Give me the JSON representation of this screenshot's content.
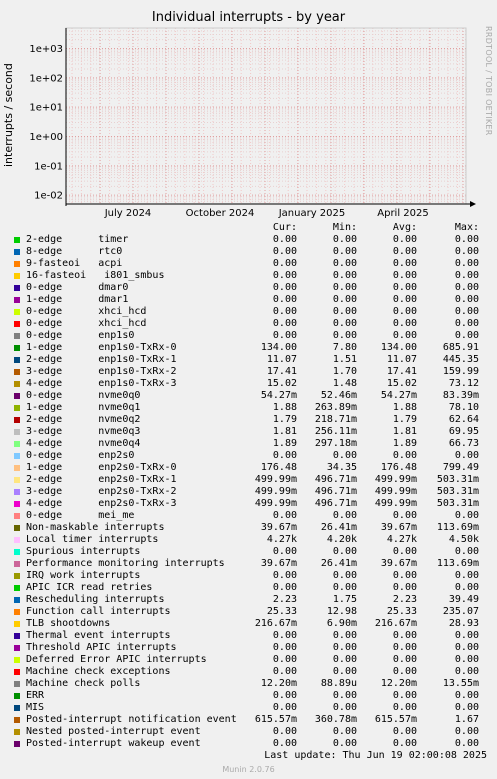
{
  "title": "Individual interrupts - by year",
  "side_text": "RRDTOOL / TOBI OETIKER",
  "chart_data": {
    "type": "line",
    "title": "Individual interrupts - by year",
    "ylabel": "interrupts / second",
    "yscale": "log",
    "ylim": [
      0.005,
      5000
    ],
    "y_ticks": [
      "1e-02",
      "1e-01",
      "1e+00",
      "1e+01",
      "1e+02",
      "1e+03"
    ],
    "x_ticks": [
      "July 2024",
      "October 2024",
      "January 2025",
      "April 2025"
    ],
    "grid": true
  },
  "legend_headers": {
    "cur": "Cur:",
    "min": "Min:",
    "avg": "Avg:",
    "max": "Max:"
  },
  "legend": [
    {
      "name": "2-edge      timer",
      "color": "#00cc00",
      "cur": "0.00",
      "min": "0.00",
      "avg": "0.00",
      "max": "0.00"
    },
    {
      "name": "8-edge      rtc0",
      "color": "#0066b3",
      "cur": "0.00",
      "min": "0.00",
      "avg": "0.00",
      "max": "0.00"
    },
    {
      "name": "9-fasteoi   acpi",
      "color": "#ff8000",
      "cur": "0.00",
      "min": "0.00",
      "avg": "0.00",
      "max": "0.00"
    },
    {
      "name": "16-fasteoi   i801_smbus",
      "color": "#ffcc00",
      "cur": "0.00",
      "min": "0.00",
      "avg": "0.00",
      "max": "0.00"
    },
    {
      "name": "0-edge      dmar0",
      "color": "#330099",
      "cur": "0.00",
      "min": "0.00",
      "avg": "0.00",
      "max": "0.00"
    },
    {
      "name": "1-edge      dmar1",
      "color": "#990099",
      "cur": "0.00",
      "min": "0.00",
      "avg": "0.00",
      "max": "0.00"
    },
    {
      "name": "0-edge      xhci_hcd",
      "color": "#ccff00",
      "cur": "0.00",
      "min": "0.00",
      "avg": "0.00",
      "max": "0.00"
    },
    {
      "name": "0-edge      xhci_hcd",
      "color": "#ff0000",
      "cur": "0.00",
      "min": "0.00",
      "avg": "0.00",
      "max": "0.00"
    },
    {
      "name": "0-edge      enp1s0",
      "color": "#808080",
      "cur": "0.00",
      "min": "0.00",
      "avg": "0.00",
      "max": "0.00"
    },
    {
      "name": "1-edge      enp1s0-TxRx-0",
      "color": "#008f00",
      "cur": "134.00",
      "min": "7.80",
      "avg": "134.00",
      "max": "685.91"
    },
    {
      "name": "2-edge      enp1s0-TxRx-1",
      "color": "#00487d",
      "cur": "11.07",
      "min": "1.51",
      "avg": "11.07",
      "max": "445.35"
    },
    {
      "name": "3-edge      enp1s0-TxRx-2",
      "color": "#b35a00",
      "cur": "17.41",
      "min": "1.70",
      "avg": "17.41",
      "max": "159.99"
    },
    {
      "name": "4-edge      enp1s0-TxRx-3",
      "color": "#b38f00",
      "cur": "15.02",
      "min": "1.48",
      "avg": "15.02",
      "max": "73.12"
    },
    {
      "name": "0-edge      nvme0q0",
      "color": "#6b006b",
      "cur": "54.27m",
      "min": "52.46m",
      "avg": "54.27m",
      "max": "83.39m"
    },
    {
      "name": "1-edge      nvme0q1",
      "color": "#8fb300",
      "cur": "1.88",
      "min": "263.89m",
      "avg": "1.88",
      "max": "78.10"
    },
    {
      "name": "2-edge      nvme0q2",
      "color": "#b30000",
      "cur": "1.79",
      "min": "218.71m",
      "avg": "1.79",
      "max": "62.64"
    },
    {
      "name": "3-edge      nvme0q3",
      "color": "#bebebe",
      "cur": "1.81",
      "min": "256.11m",
      "avg": "1.81",
      "max": "69.95"
    },
    {
      "name": "4-edge      nvme0q4",
      "color": "#80ff80",
      "cur": "1.89",
      "min": "297.18m",
      "avg": "1.89",
      "max": "66.73"
    },
    {
      "name": "0-edge      enp2s0",
      "color": "#80c9ff",
      "cur": "0.00",
      "min": "0.00",
      "avg": "0.00",
      "max": "0.00"
    },
    {
      "name": "1-edge      enp2s0-TxRx-0",
      "color": "#ffc080",
      "cur": "176.48",
      "min": "34.35",
      "avg": "176.48",
      "max": "799.49"
    },
    {
      "name": "2-edge      enp2s0-TxRx-1",
      "color": "#ffe680",
      "cur": "499.99m",
      "min": "496.71m",
      "avg": "499.99m",
      "max": "503.31m"
    },
    {
      "name": "3-edge      enp2s0-TxRx-2",
      "color": "#aa80ff",
      "cur": "499.99m",
      "min": "496.71m",
      "avg": "499.99m",
      "max": "503.31m"
    },
    {
      "name": "4-edge      enp2s0-TxRx-3",
      "color": "#ee00cc",
      "cur": "499.99m",
      "min": "496.71m",
      "avg": "499.99m",
      "max": "503.31m"
    },
    {
      "name": "0-edge      mei_me",
      "color": "#ff8080",
      "cur": "0.00",
      "min": "0.00",
      "avg": "0.00",
      "max": "0.00"
    },
    {
      "name": "Non-maskable interrupts",
      "color": "#666600",
      "cur": "39.67m",
      "min": "26.41m",
      "avg": "39.67m",
      "max": "113.69m"
    },
    {
      "name": "Local timer interrupts",
      "color": "#ffbfff",
      "cur": "4.27k",
      "min": "4.20k",
      "avg": "4.27k",
      "max": "4.50k"
    },
    {
      "name": "Spurious interrupts",
      "color": "#00ffcc",
      "cur": "0.00",
      "min": "0.00",
      "avg": "0.00",
      "max": "0.00"
    },
    {
      "name": "Performance monitoring interrupts",
      "color": "#cc6699",
      "cur": "39.67m",
      "min": "26.41m",
      "avg": "39.67m",
      "max": "113.69m"
    },
    {
      "name": "IRQ work interrupts",
      "color": "#999900",
      "cur": "0.00",
      "min": "0.00",
      "avg": "0.00",
      "max": "0.00"
    },
    {
      "name": "APIC ICR read retries",
      "color": "#00cc00",
      "cur": "0.00",
      "min": "0.00",
      "avg": "0.00",
      "max": "0.00"
    },
    {
      "name": "Rescheduling interrupts",
      "color": "#0066b3",
      "cur": "2.23",
      "min": "1.75",
      "avg": "2.23",
      "max": "39.49"
    },
    {
      "name": "Function call interrupts",
      "color": "#ff8000",
      "cur": "25.33",
      "min": "12.98",
      "avg": "25.33",
      "max": "235.07"
    },
    {
      "name": "TLB shootdowns",
      "color": "#ffcc00",
      "cur": "216.67m",
      "min": "6.90m",
      "avg": "216.67m",
      "max": "28.93"
    },
    {
      "name": "Thermal event interrupts",
      "color": "#330099",
      "cur": "0.00",
      "min": "0.00",
      "avg": "0.00",
      "max": "0.00"
    },
    {
      "name": "Threshold APIC interrupts",
      "color": "#990099",
      "cur": "0.00",
      "min": "0.00",
      "avg": "0.00",
      "max": "0.00"
    },
    {
      "name": "Deferred Error APIC interrupts",
      "color": "#ccff00",
      "cur": "0.00",
      "min": "0.00",
      "avg": "0.00",
      "max": "0.00"
    },
    {
      "name": "Machine check exceptions",
      "color": "#ff0000",
      "cur": "0.00",
      "min": "0.00",
      "avg": "0.00",
      "max": "0.00"
    },
    {
      "name": "Machine check polls",
      "color": "#808080",
      "cur": "12.20m",
      "min": "88.89u",
      "avg": "12.20m",
      "max": "13.55m"
    },
    {
      "name": "ERR",
      "color": "#008f00",
      "cur": "0.00",
      "min": "0.00",
      "avg": "0.00",
      "max": "0.00"
    },
    {
      "name": "MIS",
      "color": "#00487d",
      "cur": "0.00",
      "min": "0.00",
      "avg": "0.00",
      "max": "0.00"
    },
    {
      "name": "Posted-interrupt notification event",
      "color": "#b35a00",
      "cur": "615.57m",
      "min": "360.78m",
      "avg": "615.57m",
      "max": "1.67"
    },
    {
      "name": "Nested posted-interrupt event",
      "color": "#b38f00",
      "cur": "0.00",
      "min": "0.00",
      "avg": "0.00",
      "max": "0.00"
    },
    {
      "name": "Posted-interrupt wakeup event",
      "color": "#6b006b",
      "cur": "0.00",
      "min": "0.00",
      "avg": "0.00",
      "max": "0.00"
    }
  ],
  "last_update": "Last update:  Thu Jun 19 02:00:08 2025",
  "footer": "Munin 2.0.76"
}
